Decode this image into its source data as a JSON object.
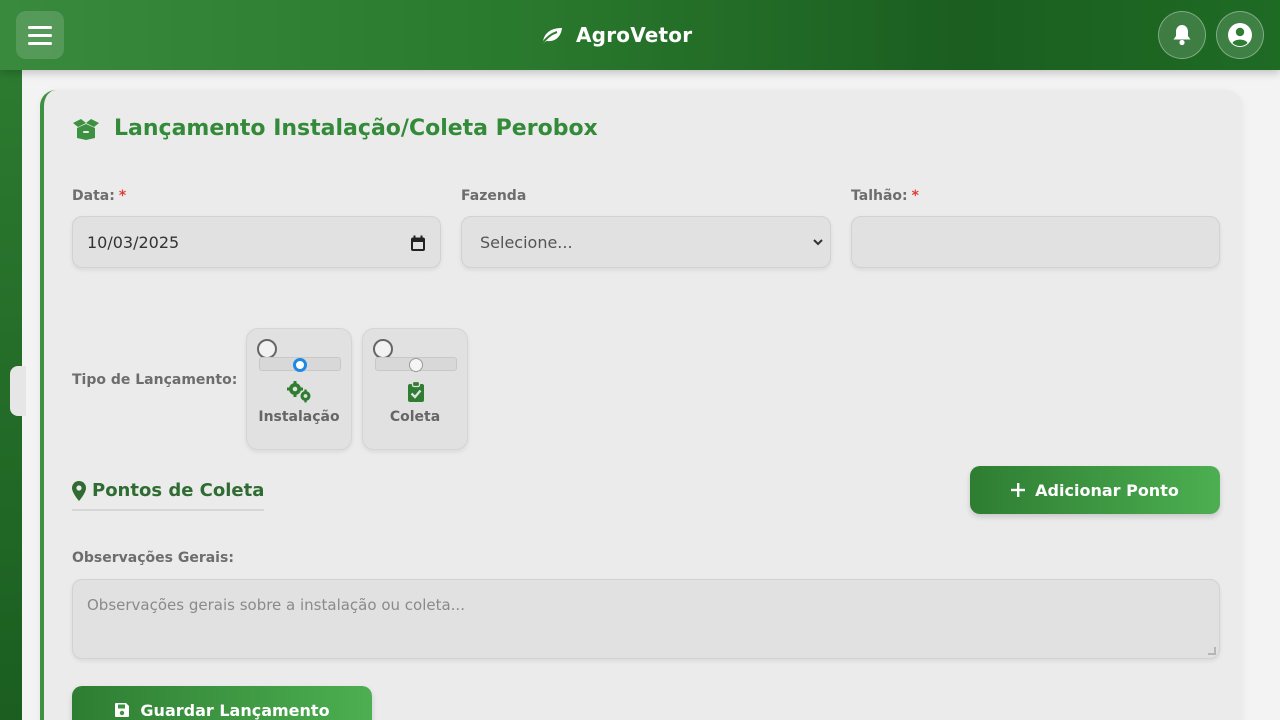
{
  "header": {
    "brand": "AgroVetor",
    "icons": {
      "menu": "hamburger-menu-icon",
      "brand": "leaf-icon",
      "notifications": "bell-icon",
      "profile": "user-circle-icon"
    },
    "colors": {
      "primary": "#2e7d32",
      "dark": "#1b5e20"
    }
  },
  "form": {
    "title": "Lançamento Instalação/Coleta Perobox",
    "title_icon": "box-icon",
    "date": {
      "label": "Data:",
      "required": "*",
      "value": "10/03/2025"
    },
    "farm": {
      "label": "Fazenda",
      "selected": "Selecione..."
    },
    "plot": {
      "label": "Talhão:",
      "required": "*",
      "value": ""
    },
    "tipo": {
      "label": "Tipo de Lançamento:",
      "options": [
        {
          "label": "Instalação",
          "icon": "cogs-icon",
          "slider_active": true
        },
        {
          "label": "Coleta",
          "icon": "clipboard-check-icon",
          "slider_active": false
        }
      ]
    },
    "points": {
      "title": "Pontos de Coleta",
      "icon": "map-marker-icon",
      "add_label": "Adicionar Ponto"
    },
    "observations": {
      "label": "Observações Gerais:",
      "placeholder": "Observações gerais sobre a instalação ou coleta..."
    },
    "save_label": "Guardar Lançamento"
  }
}
